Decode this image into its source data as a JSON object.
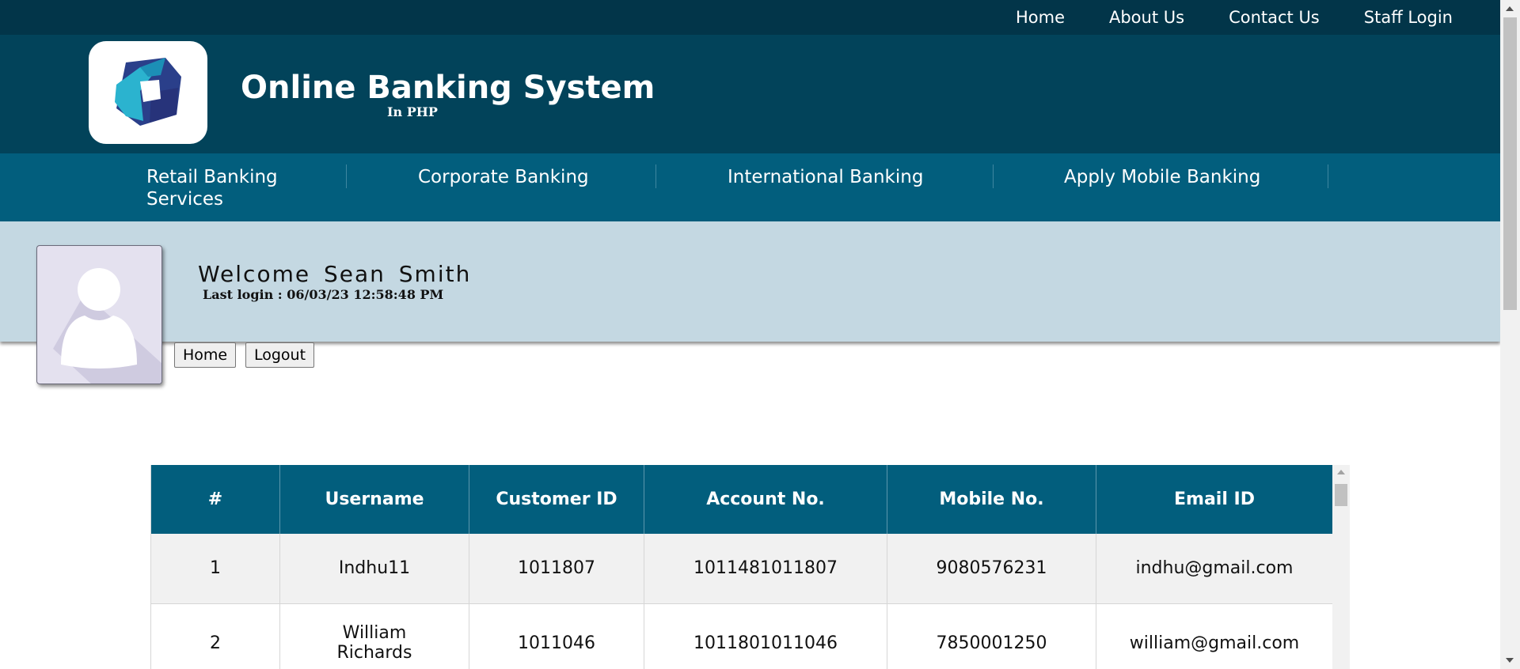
{
  "topnav": {
    "links": [
      "Home",
      "About Us",
      "Contact Us",
      "Staff Login"
    ]
  },
  "header": {
    "title": "Online Banking System",
    "subtitle": "In PHP",
    "logo_icon": "bank-logo-icon"
  },
  "mainnav": {
    "items": [
      "Retail Banking Services",
      "Corporate Banking",
      "International Banking",
      "Apply Mobile Banking"
    ]
  },
  "welcome": {
    "greeting": "Welcome  Sean  Smith",
    "last_login": "Last login : 06/03/23 12:58:48 PM",
    "avatar_icon": "user-avatar-icon"
  },
  "buttons": {
    "home": "Home",
    "logout": "Logout"
  },
  "table": {
    "headers": [
      "#",
      "Username",
      "Customer ID",
      "Account No.",
      "Mobile No.",
      "Email ID"
    ],
    "rows": [
      [
        "1",
        "Indhu11",
        "1011807",
        "1011481011807",
        "9080576231",
        "indhu@gmail.com"
      ],
      [
        "2",
        "William Richards",
        "1011046",
        "1011801011046",
        "7850001250",
        "william@gmail.com"
      ]
    ]
  },
  "colors": {
    "topbar": "#023549",
    "header": "#02435a",
    "nav": "#025e7d",
    "welcome_band": "#c4d8e2",
    "table_header": "#025e7d"
  }
}
